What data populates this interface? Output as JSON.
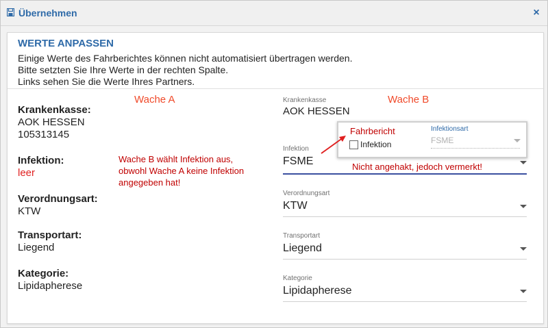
{
  "window": {
    "title": "Übernehmen",
    "close_symbol": "×"
  },
  "card": {
    "title": "WERTE ANPASSEN",
    "intro": [
      "Einige Werte des Fahrberichtes können nicht automatisiert übertragen werden.",
      "Bitte setzten Sie Ihre Werte in der rechten Spalte.",
      "Links sehen Sie die Werte Ihres Partners."
    ]
  },
  "left": {
    "krankenkasse_label": "Krankenkasse:",
    "krankenkasse_name": "AOK HESSEN",
    "krankenkasse_number": "105313145",
    "infektion_label": "Infektion:",
    "infektion_value": "leer",
    "verordnungsart_label": "Verordnungsart:",
    "verordnungsart_value": "KTW",
    "transportart_label": "Transportart:",
    "transportart_value": "Liegend",
    "kategorie_label": "Kategorie:",
    "kategorie_value": "Lipidapherese"
  },
  "right": {
    "krankenkasse": {
      "label": "Krankenkasse",
      "value": "AOK HESSEN"
    },
    "infektion": {
      "label": "Infektion",
      "value": "FSME"
    },
    "verordnungsart": {
      "label": "Verordnungsart",
      "value": "KTW"
    },
    "transportart": {
      "label": "Transportart",
      "value": "Liegend"
    },
    "kategorie": {
      "label": "Kategorie",
      "value": "Lipidapherese"
    }
  },
  "popup": {
    "title": "Fahrbericht",
    "checkbox_label": "Infektion",
    "select_label": "Infektionsart",
    "select_value": "FSME"
  },
  "annotations": {
    "wache_a": "Wache A",
    "wache_b": "Wache B",
    "note_left": [
      "Wache B wählt Infektion aus,",
      "obwohl Wache A keine Infektion",
      "angegeben hat!"
    ],
    "note_right": "Nicht angehakt, jedoch vermerkt!"
  },
  "colors": {
    "accent": "#2e6aa8",
    "annotation_orange": "#f04a2a",
    "annotation_red": "#c00000",
    "focus_underline": "#3a4fa0"
  }
}
